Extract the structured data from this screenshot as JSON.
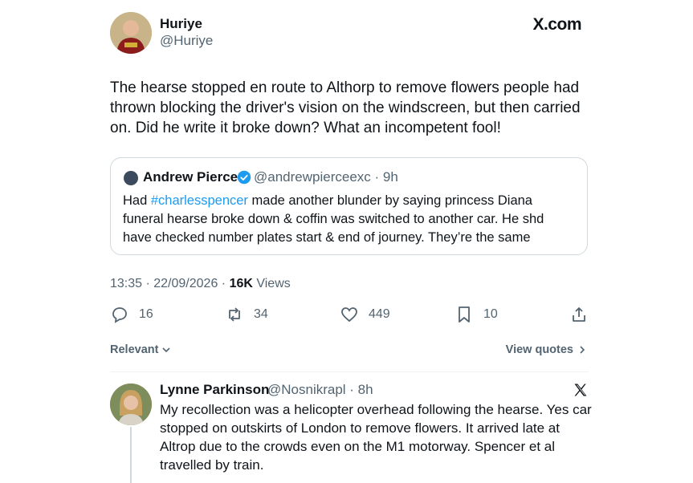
{
  "post": {
    "author_name": "Huriye",
    "author_handle": "@Huriye",
    "site_label": "X.com",
    "text": "The hearse stopped en route to Althorp to remove flowers people had thrown blocking the driver's vision on the windscreen, but then carried on. Did he write it broke down? What an incompetent fool!",
    "time_date": "13:35 · 22/09/2026 · ",
    "views_count": "16K",
    "views_label": " Views"
  },
  "quote": {
    "author_name": "Andrew Pierce",
    "author_handle_time": "@andrewpierceexc · 9h",
    "text_pre": "Had ",
    "hashtag": "#charlesspencer",
    "text_post": " made another blunder by saying princess Diana funeral hearse broke down  & coffin was switched to another car. He shd have  checked number plates start & end of journey. They’re the same"
  },
  "actions": {
    "replies": "16",
    "reposts": "34",
    "likes": "449",
    "bookmarks": "10"
  },
  "sort": {
    "relevant_label": "Relevant",
    "view_quotes_label": "View quotes"
  },
  "reply": {
    "author_name": "Lynne Parkinson",
    "author_handle_time": "@Nosnikrapl · 8h",
    "text": "My recollection was a helicopter overhead following the hearse.  Yes car stopped on outskirts of London to remove flowers.  It arrived late at Altrop due to the crowds even on the M1 motorway.  Spencer et al travelled by train."
  },
  "colors": {
    "secondary_text": "#536471",
    "link_blue": "#1d9bf0",
    "border": "#cfd9de"
  }
}
